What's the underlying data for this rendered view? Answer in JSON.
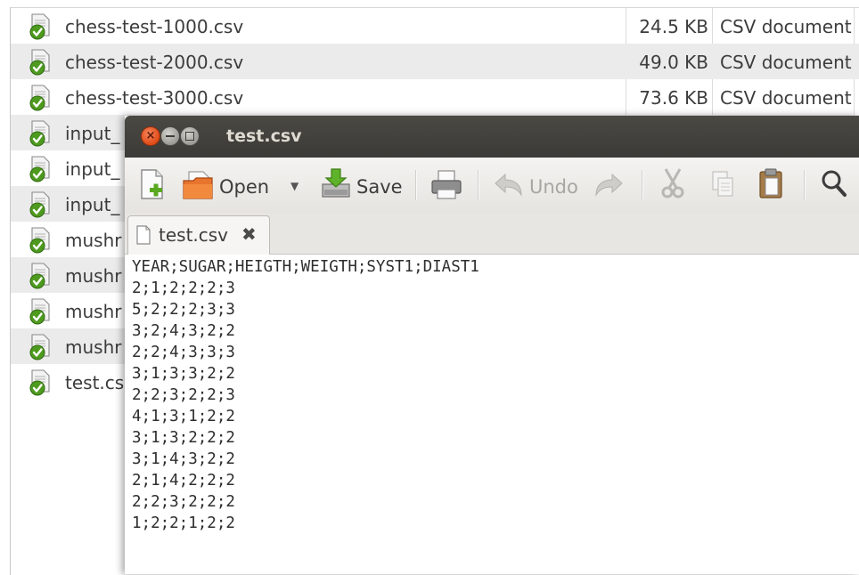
{
  "file_list": [
    {
      "name": "chess-test-1000.csv",
      "size": "24.5 KB",
      "type": "CSV document"
    },
    {
      "name": "chess-test-2000.csv",
      "size": "49.0 KB",
      "type": "CSV document"
    },
    {
      "name": "chess-test-3000.csv",
      "size": "73.6 KB",
      "type": "CSV document"
    },
    {
      "name": "input_",
      "size": "",
      "type": ""
    },
    {
      "name": "input_",
      "size": "",
      "type": ""
    },
    {
      "name": "input_",
      "size": "",
      "type": ""
    },
    {
      "name": "mushr",
      "size": "",
      "type": ""
    },
    {
      "name": "mushr",
      "size": "",
      "type": ""
    },
    {
      "name": "mushr",
      "size": "",
      "type": ""
    },
    {
      "name": "mushr",
      "size": "",
      "type": ""
    },
    {
      "name": "test.cs",
      "size": "",
      "type": ""
    }
  ],
  "file_icon": "csv-document-checked-icon",
  "window": {
    "title": "test.csv",
    "buttons": [
      "close-icon",
      "minimize-icon",
      "maximize-icon"
    ]
  },
  "toolbar": {
    "new_icon": "new-document-icon",
    "open_label": "Open",
    "open_icon": "open-folder-icon",
    "save_label": "Save",
    "save_icon": "save-icon",
    "print_icon": "print-icon",
    "undo_label": "Undo",
    "undo_icon": "undo-icon",
    "redo_icon": "redo-icon",
    "cut_icon": "cut-icon",
    "copy_icon": "copy-icon",
    "paste_icon": "paste-icon",
    "search_icon": "search-icon"
  },
  "tab": {
    "label": "test.csv",
    "close_icon": "close-tab-icon"
  },
  "editor_lines": [
    "YEAR;SUGAR;HEIGTH;WEIGTH;SYST1;DIAST1",
    "2;1;2;2;2;3",
    "5;2;2;2;3;3",
    "3;2;4;3;2;2",
    "2;2;4;3;3;3",
    "3;1;3;3;2;2",
    "2;2;3;2;2;3",
    "4;1;3;1;2;2",
    "3;1;3;2;2;2",
    "3;1;4;3;2;2",
    "2;1;4;2;2;2",
    "2;2;3;2;2;2",
    "1;2;2;1;2;2"
  ],
  "colors": {
    "titlebar": "#3c3b37",
    "close_button": "#e65a22",
    "row_alt": "#ebebeb"
  }
}
